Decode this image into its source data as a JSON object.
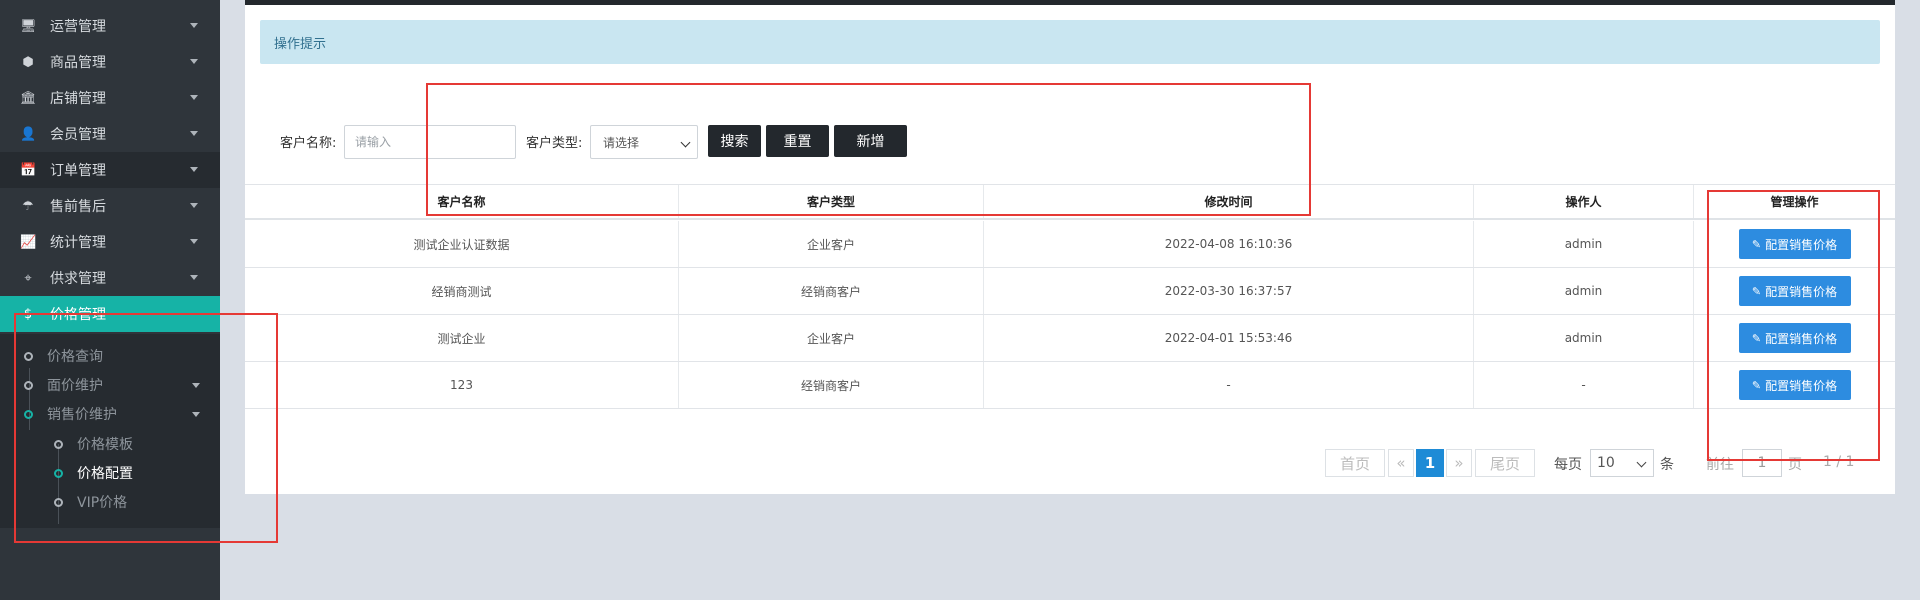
{
  "sidebar": {
    "menu": [
      {
        "label": "运营管理",
        "icon": "monitor-icon",
        "glyph": "🖥"
      },
      {
        "label": "商品管理",
        "icon": "cube-icon",
        "glyph": "⬢"
      },
      {
        "label": "店铺管理",
        "icon": "bank-icon",
        "glyph": "🏛"
      },
      {
        "label": "会员管理",
        "icon": "user-icon",
        "glyph": "👤"
      },
      {
        "label": "订单管理",
        "icon": "calendar-icon",
        "glyph": "📅"
      },
      {
        "label": "售前售后",
        "icon": "umbrella-icon",
        "glyph": "☂"
      },
      {
        "label": "统计管理",
        "icon": "area-chart-icon",
        "glyph": "📈"
      },
      {
        "label": "供求管理",
        "icon": "binoculars-icon",
        "glyph": "⌖"
      },
      {
        "label": "价格管理",
        "icon": "dollar-icon",
        "glyph": "$"
      }
    ],
    "submenu": [
      {
        "label": "价格查询"
      },
      {
        "label": "面价维护"
      },
      {
        "label": "销售价维护"
      }
    ],
    "subsubmenu": [
      {
        "label": "价格模板"
      },
      {
        "label": "价格配置"
      },
      {
        "label": "VIP价格"
      }
    ]
  },
  "main": {
    "tip": "操作提示",
    "search": {
      "name_label": "客户名称:",
      "name_placeholder": "请输入",
      "type_label": "客户类型:",
      "type_value": "请选择",
      "search_btn": "搜索",
      "reset_btn": "重置",
      "add_btn": "新增"
    },
    "table": {
      "headers": [
        "客户名称",
        "客户类型",
        "修改时间",
        "操作人",
        "管理操作"
      ],
      "rows": [
        [
          "测试企业认证数据",
          "企业客户",
          "2022-04-08 16:10:36",
          "admin"
        ],
        [
          "经销商测试",
          "经销商客户",
          "2022-03-30 16:37:57",
          "admin"
        ],
        [
          "测试企业",
          "企业客户",
          "2022-04-01 15:53:46",
          "admin"
        ],
        [
          "123",
          "经销商客户",
          "-",
          "-"
        ]
      ],
      "action_label": "配置销售价格"
    },
    "pagination": {
      "first": "首页",
      "prev": "«",
      "current": "1",
      "next": "»",
      "last": "尾页",
      "per_page_label": "每页",
      "per_page_value": "10",
      "unit": "条",
      "goto_label": "前往",
      "goto_value": "1",
      "page_unit": "页",
      "page_info": "1 / 1"
    }
  },
  "colors": {
    "sidebar_bg": "#2f353b",
    "active_teal": "#16b3a6",
    "primary_blue": "#2d8ce0",
    "annotation_red": "#e53935"
  }
}
